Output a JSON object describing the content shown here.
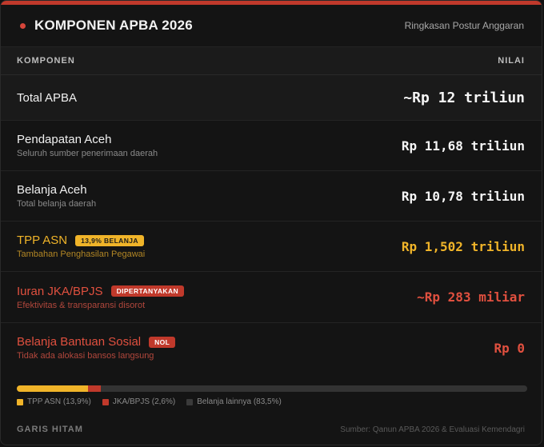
{
  "header": {
    "title": "KOMPONEN APBA 2026",
    "subtitle": "Ringkasan Postur Anggaran"
  },
  "columns": {
    "left": "KOMPONEN",
    "right": "NILAI"
  },
  "rows": [
    {
      "name": "Total APBA",
      "desc": "",
      "badge": "",
      "value": "~Rp 12 triliun"
    },
    {
      "name": "Pendapatan Aceh",
      "desc": "Seluruh sumber penerimaan daerah",
      "badge": "",
      "value": "Rp 11,68 triliun"
    },
    {
      "name": "Belanja Aceh",
      "desc": "Total belanja daerah",
      "badge": "",
      "value": "Rp 10,78 triliun"
    },
    {
      "name": "TPP ASN",
      "desc": "Tambahan Penghasilan Pegawai",
      "badge": "13,9% BELANJA",
      "value": "Rp 1,502 triliun"
    },
    {
      "name": "Iuran JKA/BPJS",
      "desc": "Efektivitas & transparansi disorot",
      "badge": "DIPERTANYAKAN",
      "value": "~Rp 283 miliar"
    },
    {
      "name": "Belanja Bantuan Sosial",
      "desc": "Tidak ada alokasi bansos langsung",
      "badge": "NOL",
      "value": "Rp 0"
    }
  ],
  "breakdown": {
    "segments": [
      {
        "label": "TPP ASN (13,9%)",
        "percent": 13.9,
        "color": "#f0b429"
      },
      {
        "label": "JKA/BPJS (2,6%)",
        "percent": 2.6,
        "color": "#c0392b"
      },
      {
        "label": "Belanja lainnya (83,5%)",
        "percent": 83.5,
        "color": "#333333"
      }
    ]
  },
  "footer": {
    "brand": "GARIS HITAM",
    "source": "Sumber: Qanun APBA 2026 & Evaluasi Kemendagri"
  },
  "colors": {
    "accent": "#c0392b",
    "amber": "#f0b429",
    "red": "#e0503f"
  }
}
